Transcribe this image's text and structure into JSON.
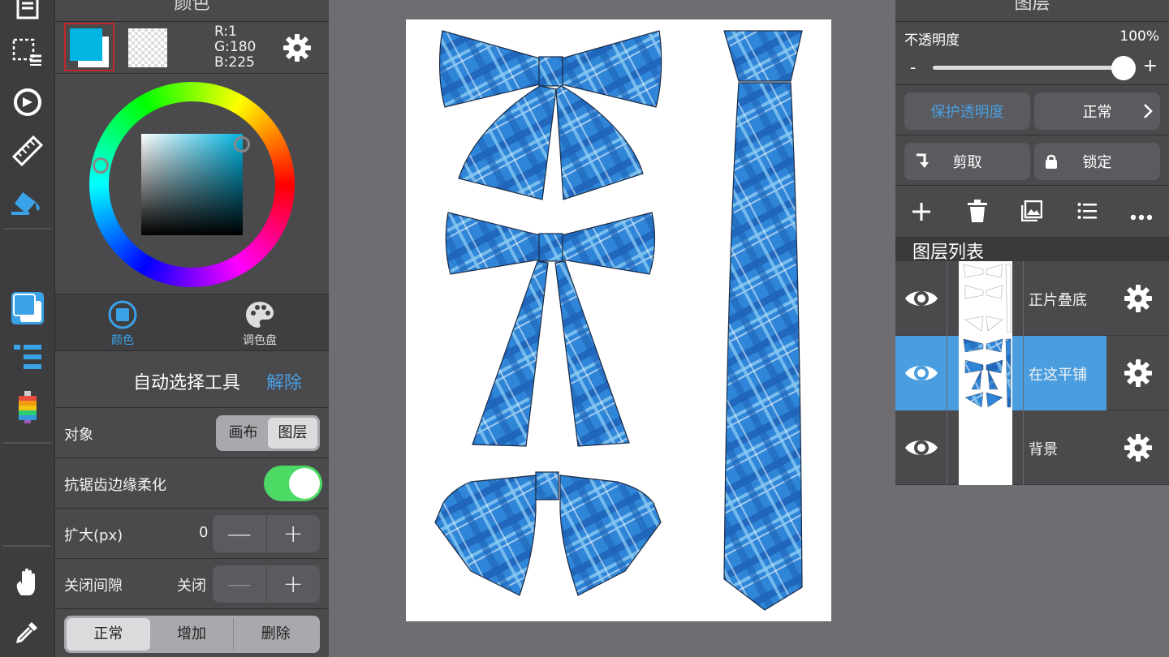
{
  "toolbar": {
    "icons": [
      "layers-list-icon",
      "selection-icon",
      "rotate-icon",
      "ruler-icon",
      "fill-bucket-icon",
      "color-swatch-icon",
      "layer-menu-icon",
      "brush-stroke-icon",
      "hand-icon",
      "eyedropper-icon"
    ]
  },
  "color_panel": {
    "title": "颜色",
    "rgb": {
      "r": "R:1",
      "g": "G:180",
      "b": "B:225"
    },
    "primary_color": "#01b4e1",
    "tabs": [
      {
        "label": "颜色",
        "active": true
      },
      {
        "label": "调色盘",
        "active": false
      }
    ],
    "tool": {
      "title": "自动选择工具",
      "release_label": "解除"
    },
    "target": {
      "label": "对象",
      "options": [
        "画布",
        "图层"
      ],
      "selected": "图层"
    },
    "antialias": {
      "label": "抗锯齿边缘柔化",
      "on": true
    },
    "expand": {
      "label": "扩大(px)",
      "value": "0",
      "minus": "—",
      "plus": "+"
    },
    "gap_close": {
      "label": "关闭间隙",
      "value": "关闭",
      "minus": "—",
      "plus": "+"
    },
    "mode": {
      "options": [
        "正常",
        "增加",
        "删除"
      ],
      "selected": "正常"
    }
  },
  "layer_panel": {
    "title": "图层",
    "opacity": {
      "label": "不透明度",
      "value": "100%",
      "minus": "-",
      "plus": "+",
      "level": 1.0
    },
    "protect_label": "保护透明度",
    "blend_label": "正常",
    "clip_label": "剪取",
    "lock_label": "锁定",
    "list_title": "图层列表",
    "layers": [
      {
        "name": "正片叠底",
        "selected": false
      },
      {
        "name": "在这平铺",
        "selected": true
      },
      {
        "name": "背景",
        "selected": false
      }
    ]
  },
  "colors": {
    "accent": "#4a9ee0",
    "selected_layer": "#4a9ee0",
    "toggle_on": "#4cd964",
    "plaid": "#2f86d8"
  }
}
